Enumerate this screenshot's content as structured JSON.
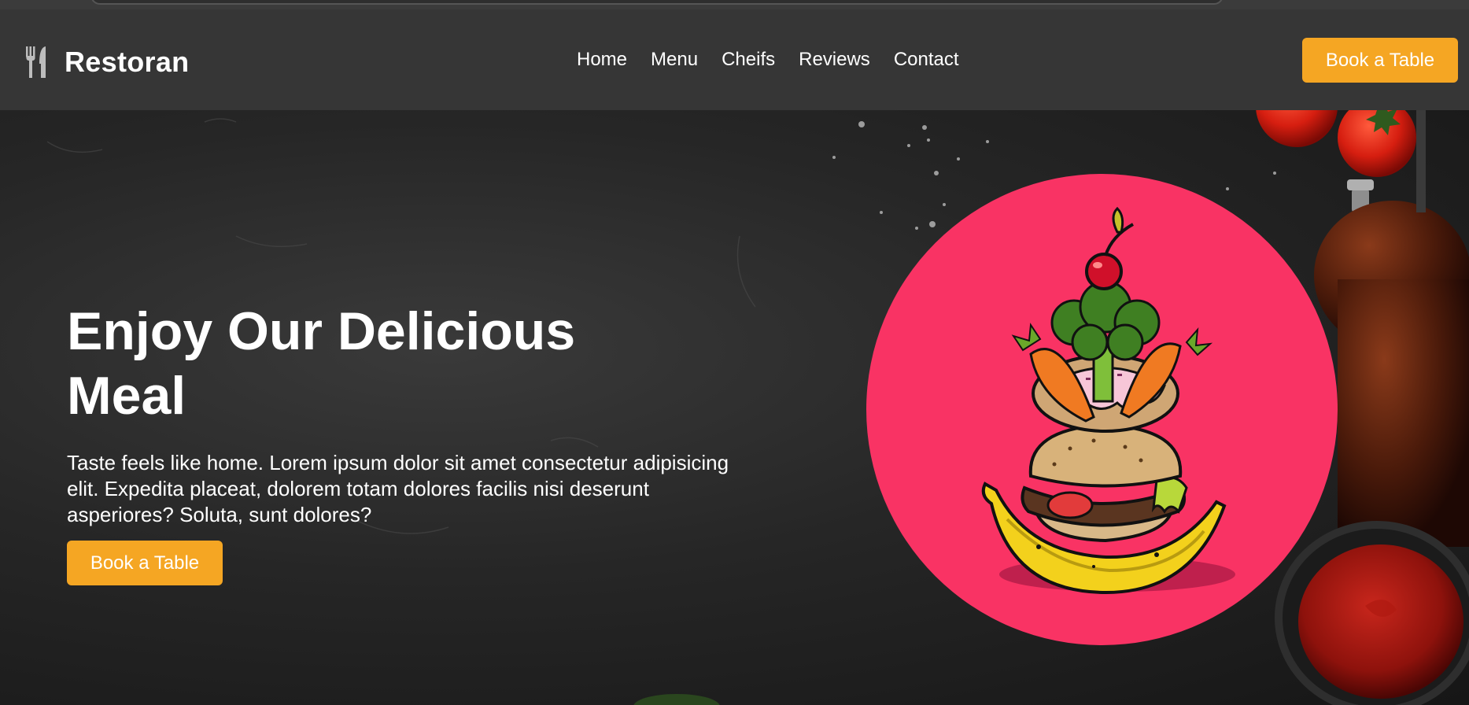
{
  "brand": {
    "name": "Restoran",
    "icon": "utensils-icon"
  },
  "nav": {
    "items": [
      "Home",
      "Menu",
      "Cheifs",
      "Reviews",
      "Contact"
    ]
  },
  "header": {
    "cta_label": "Book a Table"
  },
  "hero": {
    "title": "Enjoy Our Delicious Meal",
    "description": "Taste feels like home. Lorem ipsum dolor sit amet consectetur adipisicing elit. Expedita placeat, dolorem totam dolores facilis nisi deserunt asperiores? Soluta, sunt dolores?",
    "cta_label": "Book a Table",
    "image": "stacked-food-illustration"
  },
  "colors": {
    "accent": "#f5a623",
    "plate": "#f93364",
    "header_bg": "#363636"
  }
}
